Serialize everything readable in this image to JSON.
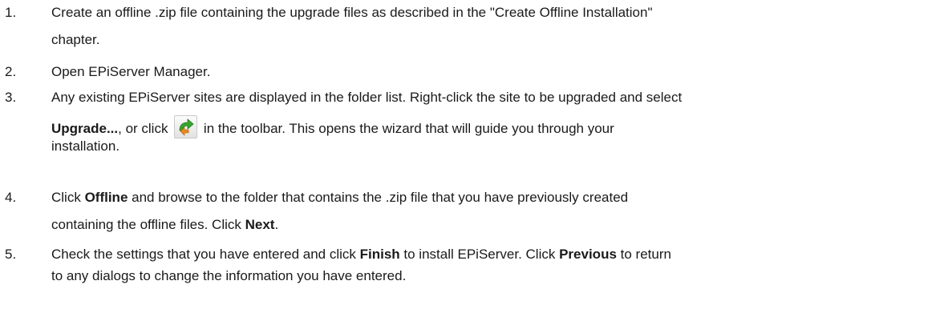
{
  "steps": [
    {
      "number": "1.",
      "line1": "Create an offline .zip file containing the upgrade files as described in the \"Create Offline Installation\"",
      "line2": "chapter."
    },
    {
      "number": "2.",
      "line1": "Open EPiServer Manager."
    },
    {
      "number": "3.",
      "line1": "Any existing EPiServer sites are displayed in the folder list. Right-click the site to be upgraded and select",
      "bold1": "Upgrade...",
      "text1": ", or click ",
      "icon": "upgrade-toolbar-icon",
      "text2": " in the toolbar. This opens the wizard that will guide you through your",
      "line3": "installation."
    },
    {
      "number": "4.",
      "text1": "Click ",
      "bold1": "Offline",
      "text2": " and browse to the folder that contains the .zip file that you have previously created",
      "text3": "containing the offline files. Click ",
      "bold2": "Next",
      "text4": "."
    },
    {
      "number": "5.",
      "text1": "Check the settings that you have entered and click ",
      "bold1": "Finish",
      "text2": " to install EPiServer. Click ",
      "bold2": "Previous",
      "text3": " to return",
      "line2": "to any dialogs to change the information you have entered."
    }
  ],
  "icon_colors": {
    "arrow_green": "#3aa52e",
    "arrow_orange": "#e88a1c",
    "button_border": "#c9c9c9"
  }
}
